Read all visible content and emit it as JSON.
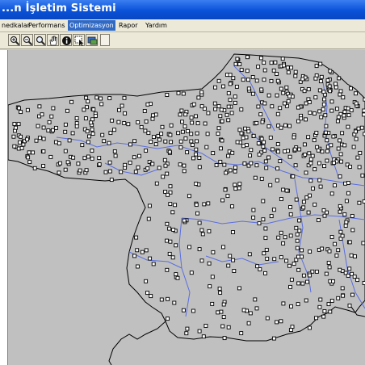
{
  "window": {
    "title": "...n İşletim Sistemi"
  },
  "menu": {
    "items": [
      {
        "label": "nedkalar",
        "active": false
      },
      {
        "label": "Performans",
        "active": false
      },
      {
        "label": "Optimizasyon",
        "active": true
      },
      {
        "label": "Rapor",
        "active": false
      },
      {
        "label": "Yardım",
        "active": false
      }
    ]
  },
  "toolbar": {
    "tools": [
      "zoom-in-icon",
      "zoom-out-icon",
      "zoom-region-icon",
      "pan-hand-icon",
      "info-icon",
      "select-icon",
      "layers-icon"
    ]
  },
  "map": {
    "land_color": "#c0c0c0",
    "border_color": "#000000",
    "river_color": "#5a6ee0",
    "marker_fill": "#ffffff",
    "marker_border": "#000000"
  }
}
